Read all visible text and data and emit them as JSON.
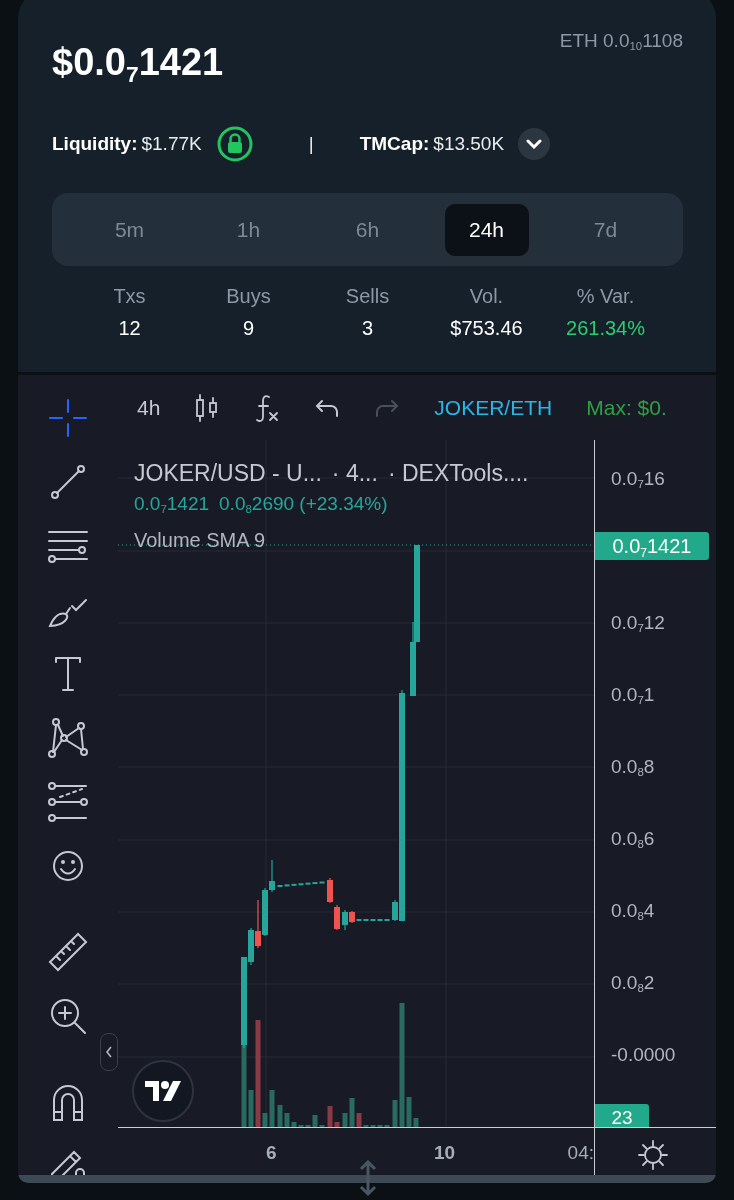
{
  "header": {
    "price": "$0.0$_{7}$1421",
    "eth_price": "ETH 0.0$_{10}$1108"
  },
  "metrics": {
    "liquidity_label": "Liquidity:",
    "liquidity_value": "$1.77K",
    "locked": true,
    "separator": "|",
    "tmcap_label": "TMCap:",
    "tmcap_value": "$13.50K"
  },
  "timeframes": [
    {
      "label": "5m",
      "selected": false
    },
    {
      "label": "1h",
      "selected": false
    },
    {
      "label": "6h",
      "selected": false
    },
    {
      "label": "24h",
      "selected": true
    },
    {
      "label": "7d",
      "selected": false
    }
  ],
  "stats": [
    {
      "label": "Txs",
      "value": "12",
      "kind": "plain"
    },
    {
      "label": "Buys",
      "value": "9",
      "kind": "plain"
    },
    {
      "label": "Sells",
      "value": "3",
      "kind": "plain"
    },
    {
      "label": "Vol.",
      "value": "$753.46",
      "kind": "plain"
    },
    {
      "label": "% Var.",
      "value": "261.34%",
      "kind": "change"
    }
  ],
  "chart": {
    "toolbar": {
      "interval": "4h",
      "actions": [
        {
          "kind": "candles",
          "disabled": false
        },
        {
          "kind": "indicators",
          "disabled": false
        },
        {
          "kind": "undo",
          "disabled": false
        },
        {
          "kind": "redo",
          "disabled": true
        }
      ],
      "symbol": "JOKER/ETH",
      "max": "Max: $0."
    },
    "tool_groups": [
      {
        "tools": [
          {
            "kind": "crosshair",
            "selected": true
          },
          {
            "kind": "trend-line",
            "selected": false
          },
          {
            "kind": "fib",
            "selected": false
          },
          {
            "kind": "brush",
            "selected": false
          },
          {
            "kind": "text",
            "selected": false
          },
          {
            "kind": "pattern",
            "selected": false
          },
          {
            "kind": "forecast",
            "selected": false
          },
          {
            "kind": "emoji",
            "selected": false
          }
        ]
      },
      {
        "tools": [
          {
            "kind": "ruler",
            "selected": false
          },
          {
            "kind": "zoom",
            "selected": false
          }
        ]
      },
      {
        "tools": [
          {
            "kind": "magnet",
            "selected": false
          },
          {
            "kind": "lock-pencil",
            "selected": false
          }
        ]
      }
    ],
    "legend": {
      "title": "JOKER/USD - U...",
      "interval": "· 4...",
      "source": "· DEXTools....",
      "last": "0.0$_{7}$1421",
      "change": "0.0$_{8}$2690 (+23.34%)",
      "indicator": "Volume SMA 9"
    },
    "price_axis": [
      "0.0$_{7}$16",
      "0.0$_{7}$12",
      "0.0$_{7}$1",
      "0.0$_{8}$8",
      "0.0$_{8}$6",
      "0.0$_{8}$4",
      "0.0$_{8}$2",
      "-0.0000"
    ],
    "last_price": "0.0$_{7}$1421",
    "volume_tag": "23",
    "time_labels": [
      "6",
      "10",
      "04:"
    ]
  }
}
